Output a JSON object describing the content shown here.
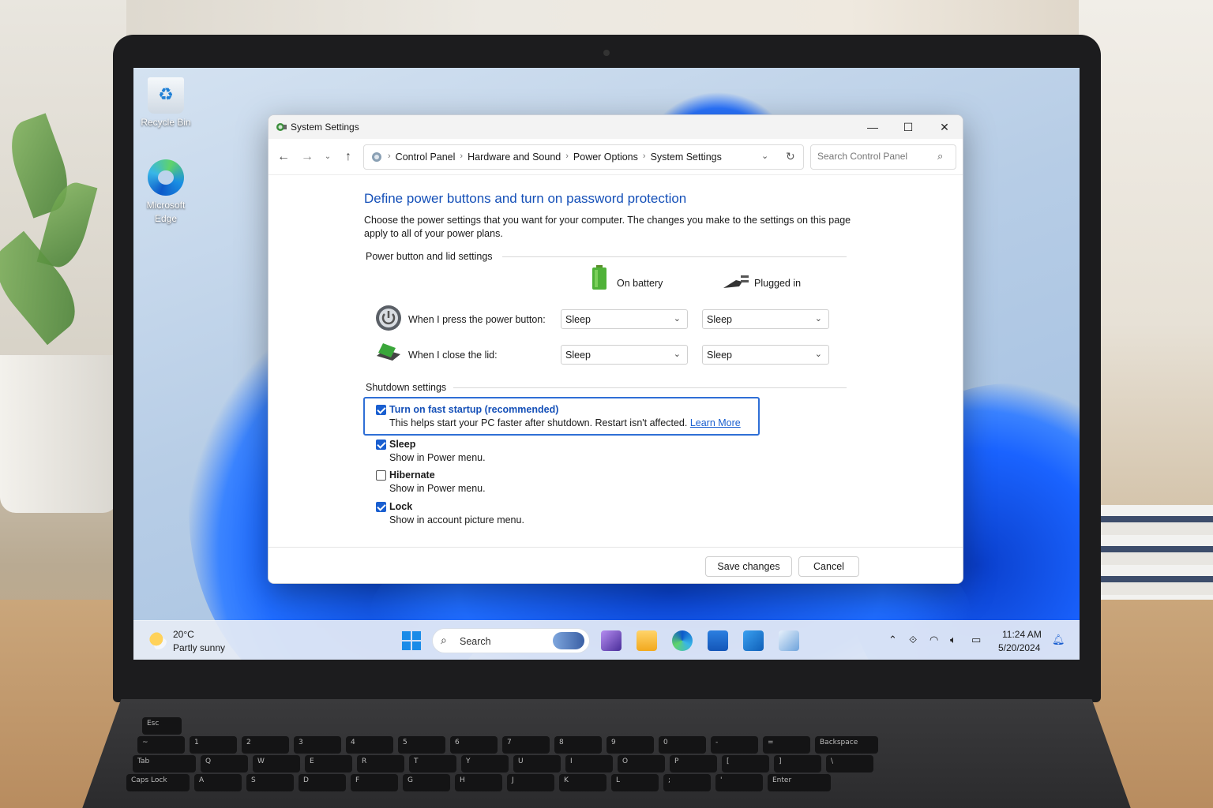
{
  "desktop": {
    "icons": [
      {
        "label": "Recycle Bin"
      },
      {
        "label": "Microsoft Edge"
      }
    ]
  },
  "window": {
    "title": "System Settings",
    "controls": {
      "minimize": "—",
      "maximize": "☐",
      "close": "✕"
    }
  },
  "nav": {
    "breadcrumbs": [
      "Control Panel",
      "Hardware and Sound",
      "Power Options",
      "System Settings"
    ],
    "search_placeholder": "Search Control Panel"
  },
  "page": {
    "heading": "Define power buttons and turn on password protection",
    "description": "Choose the power settings that you want for your computer. The changes you make to the settings on this page apply to all of your power plans.",
    "power_section": "Power button and lid settings",
    "columns": {
      "battery": "On battery",
      "plugged": "Plugged in"
    },
    "rows": [
      {
        "label": "When I press the power button:",
        "battery": "Sleep",
        "plugged": "Sleep"
      },
      {
        "label": "When I close the lid:",
        "battery": "Sleep",
        "plugged": "Sleep"
      }
    ],
    "shutdown_section": "Shutdown settings",
    "options": [
      {
        "title": "Turn on fast startup (recommended)",
        "subtitle": "This helps start your PC faster after shutdown. Restart isn't affected.",
        "link": "Learn More",
        "checked": true
      },
      {
        "title": "Sleep",
        "subtitle": "Show in Power menu.",
        "checked": true
      },
      {
        "title": "Hibernate",
        "subtitle": "Show in Power menu.",
        "checked": false
      },
      {
        "title": "Lock",
        "subtitle": "Show in account picture menu.",
        "checked": true
      }
    ]
  },
  "footer": {
    "save": "Save changes",
    "cancel": "Cancel"
  },
  "taskbar": {
    "weather": {
      "temp": "20°C",
      "desc": "Partly sunny"
    },
    "search_label": "Search",
    "time": "11:24 AM",
    "date": "5/20/2024"
  },
  "colors": {
    "accent": "#1a5fd0",
    "heading": "#1550b8",
    "focus_border": "#2f6fd6"
  },
  "keyboard": {
    "row1": [
      "Esc"
    ],
    "row2": [
      "~",
      "1",
      "2",
      "3",
      "4",
      "5",
      "6",
      "7",
      "8",
      "9",
      "0",
      "-",
      "=",
      "Backspace"
    ],
    "row3": [
      "Tab",
      "Q",
      "W",
      "E",
      "R",
      "T",
      "Y",
      "U",
      "I",
      "O",
      "P",
      "[",
      "]",
      "\\"
    ],
    "row4": [
      "Caps Lock",
      "A",
      "S",
      "D",
      "F",
      "G",
      "H",
      "J",
      "K",
      "L",
      ";",
      "'",
      "Enter"
    ]
  }
}
